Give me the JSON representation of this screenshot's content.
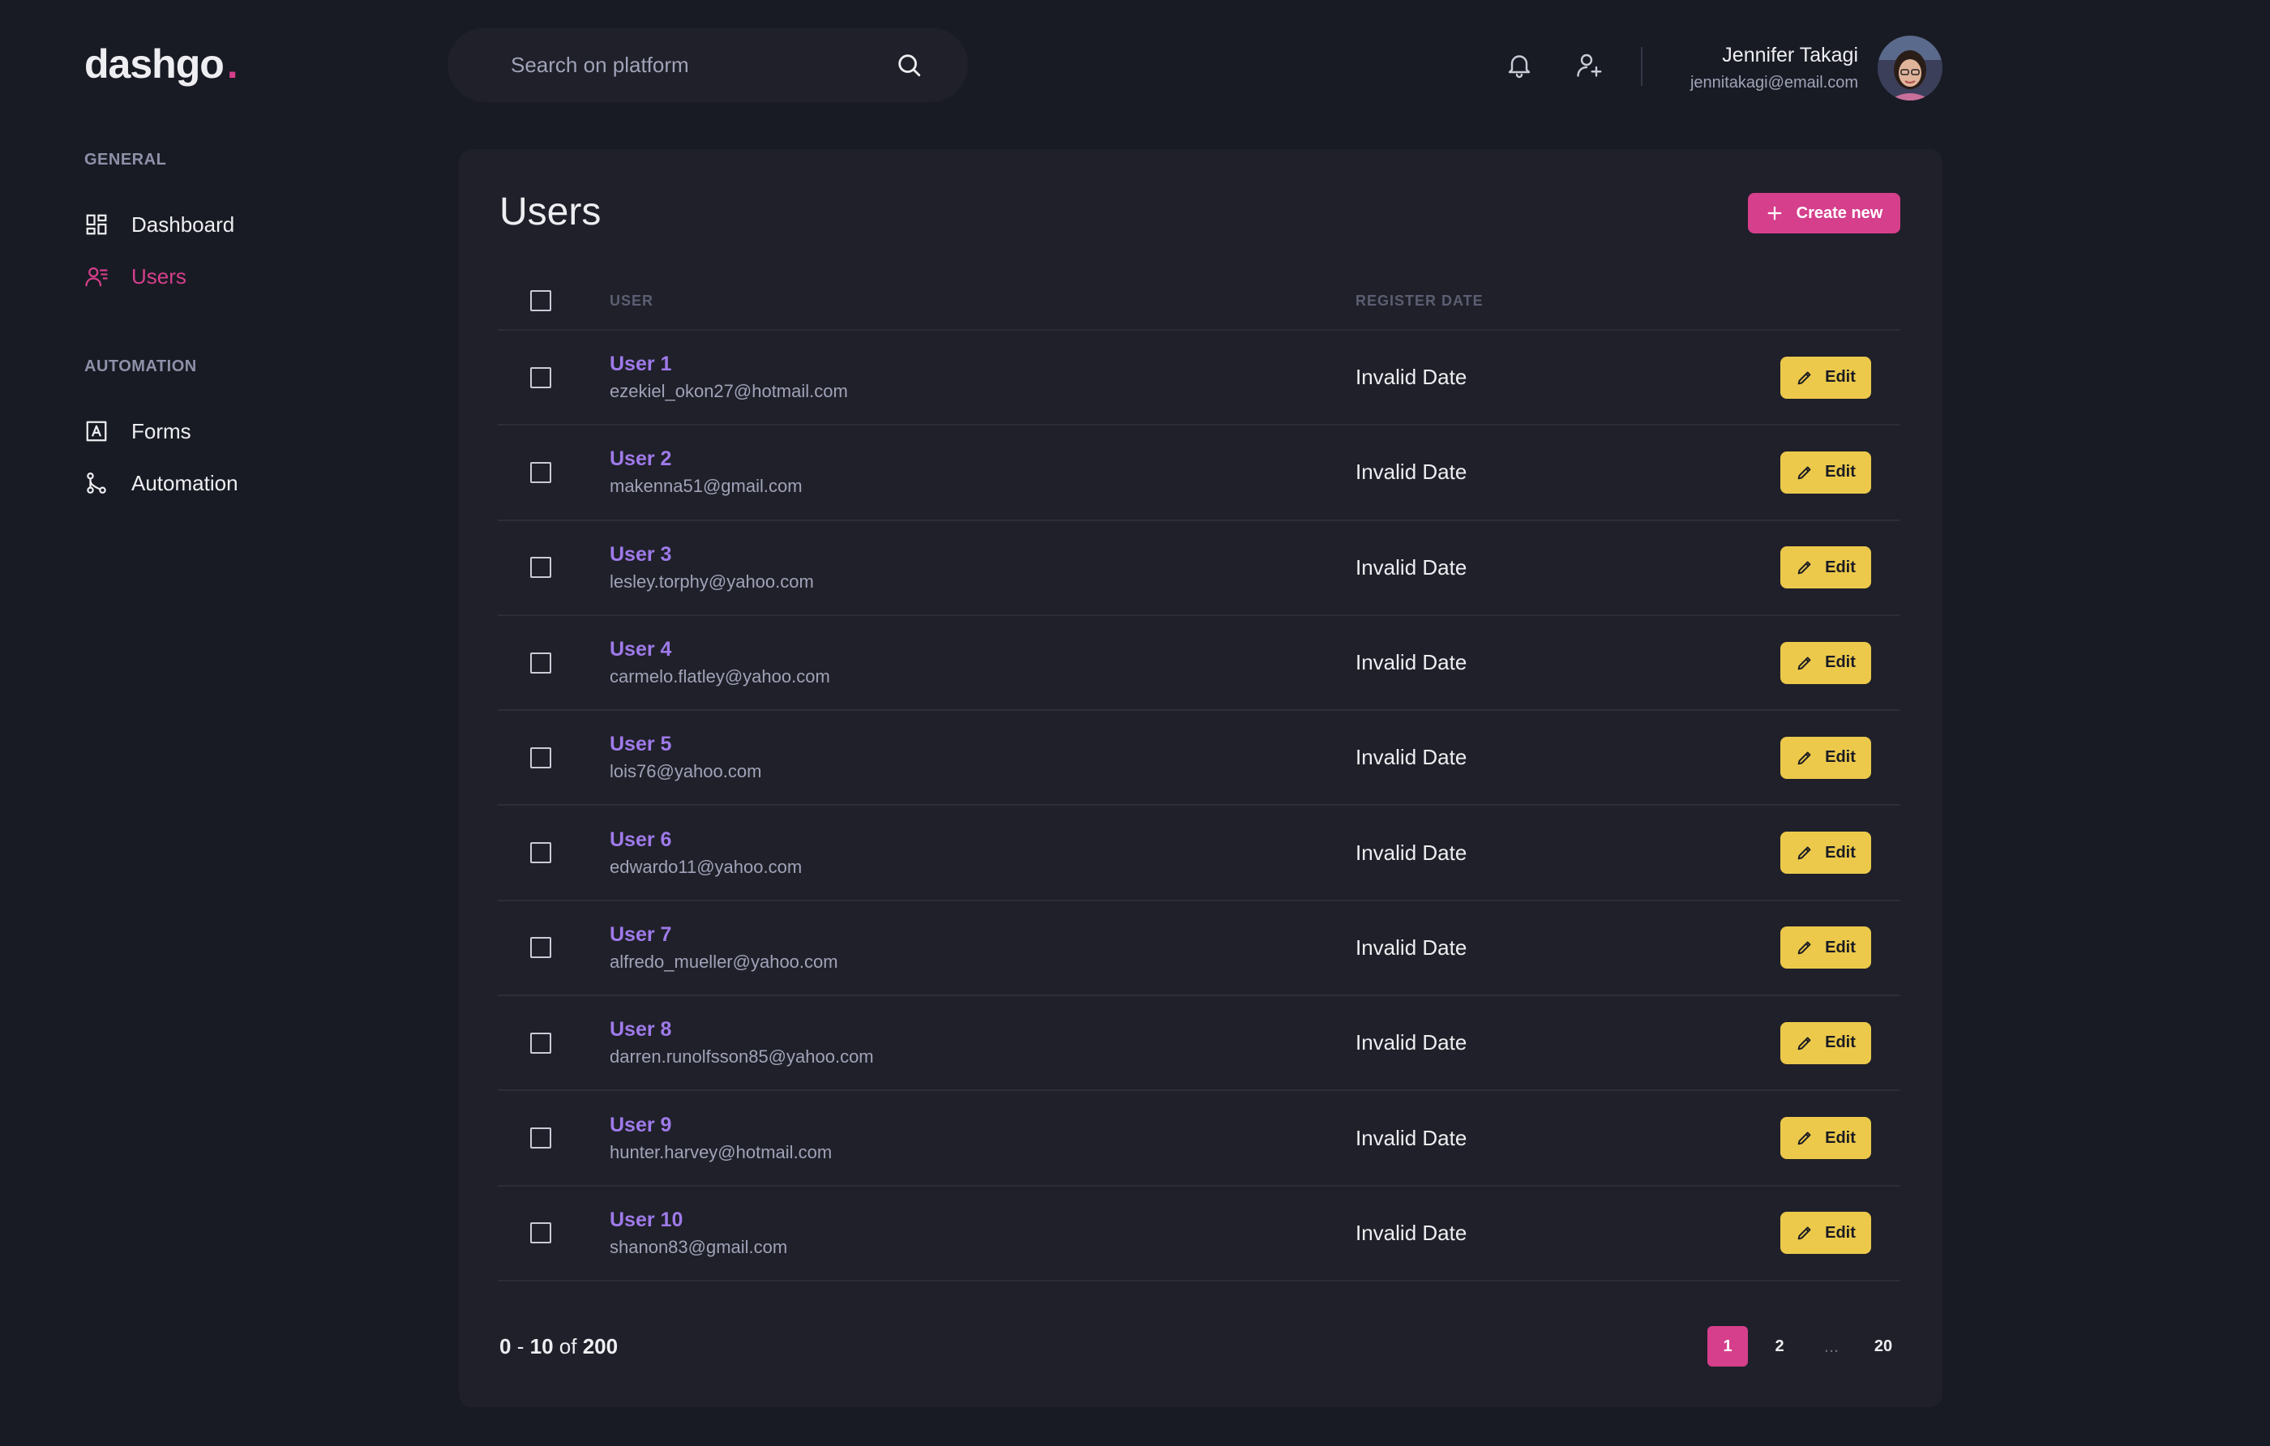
{
  "brand": {
    "name": "dashgo",
    "dot": ".",
    "accent": "#d53f8c"
  },
  "search": {
    "placeholder": "Search on platform",
    "value": ""
  },
  "header": {
    "icons": [
      "bell-icon",
      "user-add-icon"
    ],
    "profile": {
      "name": "Jennifer Takagi",
      "email": "jennitakagi@email.com"
    }
  },
  "sidebar": {
    "sections": [
      {
        "title": "GENERAL",
        "items": [
          {
            "label": "Dashboard",
            "icon": "dashboard-icon",
            "active": false
          },
          {
            "label": "Users",
            "icon": "users-icon",
            "active": true
          }
        ]
      },
      {
        "title": "AUTOMATION",
        "items": [
          {
            "label": "Forms",
            "icon": "forms-icon",
            "active": false
          },
          {
            "label": "Automation",
            "icon": "automation-icon",
            "active": false
          }
        ]
      }
    ]
  },
  "main": {
    "title": "Users",
    "create_label": "Create new",
    "columns": {
      "user": "USER",
      "date": "REGISTER DATE"
    },
    "edit_label": "Edit",
    "rows": [
      {
        "name": "User 1",
        "email": "ezekiel_okon27@hotmail.com",
        "date": "Invalid Date"
      },
      {
        "name": "User 2",
        "email": "makenna51@gmail.com",
        "date": "Invalid Date"
      },
      {
        "name": "User 3",
        "email": "lesley.torphy@yahoo.com",
        "date": "Invalid Date"
      },
      {
        "name": "User 4",
        "email": "carmelo.flatley@yahoo.com",
        "date": "Invalid Date"
      },
      {
        "name": "User 5",
        "email": "lois76@yahoo.com",
        "date": "Invalid Date"
      },
      {
        "name": "User 6",
        "email": "edwardo11@yahoo.com",
        "date": "Invalid Date"
      },
      {
        "name": "User 7",
        "email": "alfredo_mueller@yahoo.com",
        "date": "Invalid Date"
      },
      {
        "name": "User 8",
        "email": "darren.runolfsson85@yahoo.com",
        "date": "Invalid Date"
      },
      {
        "name": "User 9",
        "email": "hunter.harvey@hotmail.com",
        "date": "Invalid Date"
      },
      {
        "name": "User 10",
        "email": "shanon83@gmail.com",
        "date": "Invalid Date"
      }
    ],
    "pagination": {
      "range_start": "0",
      "range_sep": "-",
      "range_end": "10",
      "of": "of",
      "total": "200",
      "pages": [
        {
          "label": "1",
          "active": true
        },
        {
          "label": "2",
          "active": false
        },
        {
          "label": "...",
          "ellipsis": true
        },
        {
          "label": "20",
          "active": false
        }
      ]
    }
  },
  "colors": {
    "background": "#181b23",
    "panel": "#1f2029",
    "pink": "#d53f8c",
    "purple": "#9f7aea",
    "yellow": "#ecc94b"
  }
}
